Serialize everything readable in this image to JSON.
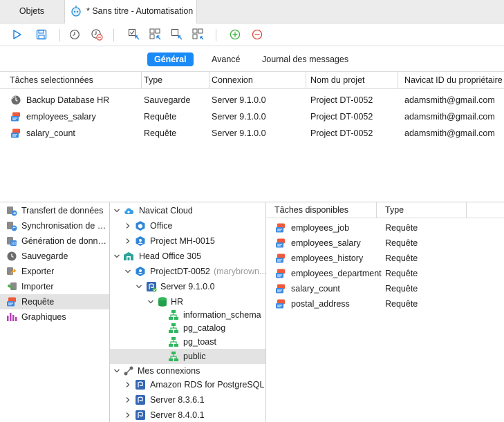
{
  "window_tabs": {
    "objects_label": "Objets",
    "automation_label": "* Sans titre - Automatisation"
  },
  "toolbar": {
    "icons": [
      "run-icon",
      "save-icon",
      "schedule-icon",
      "remove-schedule-icon",
      "select-all-icon",
      "deselect-all-icon",
      "select-icon",
      "unselect-icon",
      "add-icon",
      "remove-icon"
    ]
  },
  "subtabs": {
    "general": "Général",
    "advanced": "Avancé",
    "log": "Journal des messages"
  },
  "selected_tasks": {
    "headers": [
      "Tâches selectionnées",
      "Type",
      "Connexion",
      "Nom du projet",
      "Navicat ID du propriétaire"
    ],
    "rows": [
      {
        "icon": "backup-icon",
        "name": "Backup Database HR",
        "type": "Sauvegarde",
        "connection": "Server 9.1.0.0",
        "project": "Project DT-0052",
        "owner": "adamsmith@gmail.com"
      },
      {
        "icon": "query-icon",
        "name": "employees_salary",
        "type": "Requête",
        "connection": "Server 9.1.0.0",
        "project": "Project DT-0052",
        "owner": "adamsmith@gmail.com"
      },
      {
        "icon": "query-icon",
        "name": "salary_count",
        "type": "Requête",
        "connection": "Server 9.1.0.0",
        "project": "Project DT-0052",
        "owner": "adamsmith@gmail.com"
      }
    ]
  },
  "categories": [
    {
      "label": "Transfert de données",
      "icon": "transfer-icon"
    },
    {
      "label": "Synchronisation de données",
      "icon": "sync-icon"
    },
    {
      "label": "Génération de données",
      "icon": "data-generation-icon"
    },
    {
      "label": "Sauvegarde",
      "icon": "backup-icon"
    },
    {
      "label": "Exporter",
      "icon": "export-icon"
    },
    {
      "label": "Importer",
      "icon": "import-icon"
    },
    {
      "label": "Requête",
      "icon": "query-icon",
      "selected": true
    },
    {
      "label": "Graphiques",
      "icon": "charts-icon"
    }
  ],
  "tree": {
    "navicat_cloud": "Navicat Cloud",
    "office": "Office",
    "project_mh": "Project MH-0015",
    "head_office": "Head Office 305",
    "project_dt": "ProjectDT-0052",
    "project_dt_owner": "(marybrown...",
    "server_9": "Server 9.1.0.0",
    "hr": "HR",
    "schema_info": "information_schema",
    "schema_catalog": "pg_catalog",
    "schema_toast": "pg_toast",
    "schema_public": "public",
    "my_connections": "Mes connexions",
    "amazon": "Amazon RDS for PostgreSQL",
    "server_8361": "Server 8.3.6.1",
    "server_8401": "Server 8.4.0.1"
  },
  "available_tasks": {
    "headers": [
      "Tâches disponibles",
      "Type"
    ],
    "rows": [
      {
        "name": "employees_job",
        "type": "Requête"
      },
      {
        "name": "employees_salary",
        "type": "Requête"
      },
      {
        "name": "employees_history",
        "type": "Requête"
      },
      {
        "name": "employees_department",
        "type": "Requête"
      },
      {
        "name": "salary_count",
        "type": "Requête"
      },
      {
        "name": "postal_address",
        "type": "Requête"
      }
    ]
  },
  "colors": {
    "accent": "#1a8af6",
    "add_green": "#34b233",
    "remove_red": "#e0443a",
    "selection": "#e3e3e3"
  }
}
